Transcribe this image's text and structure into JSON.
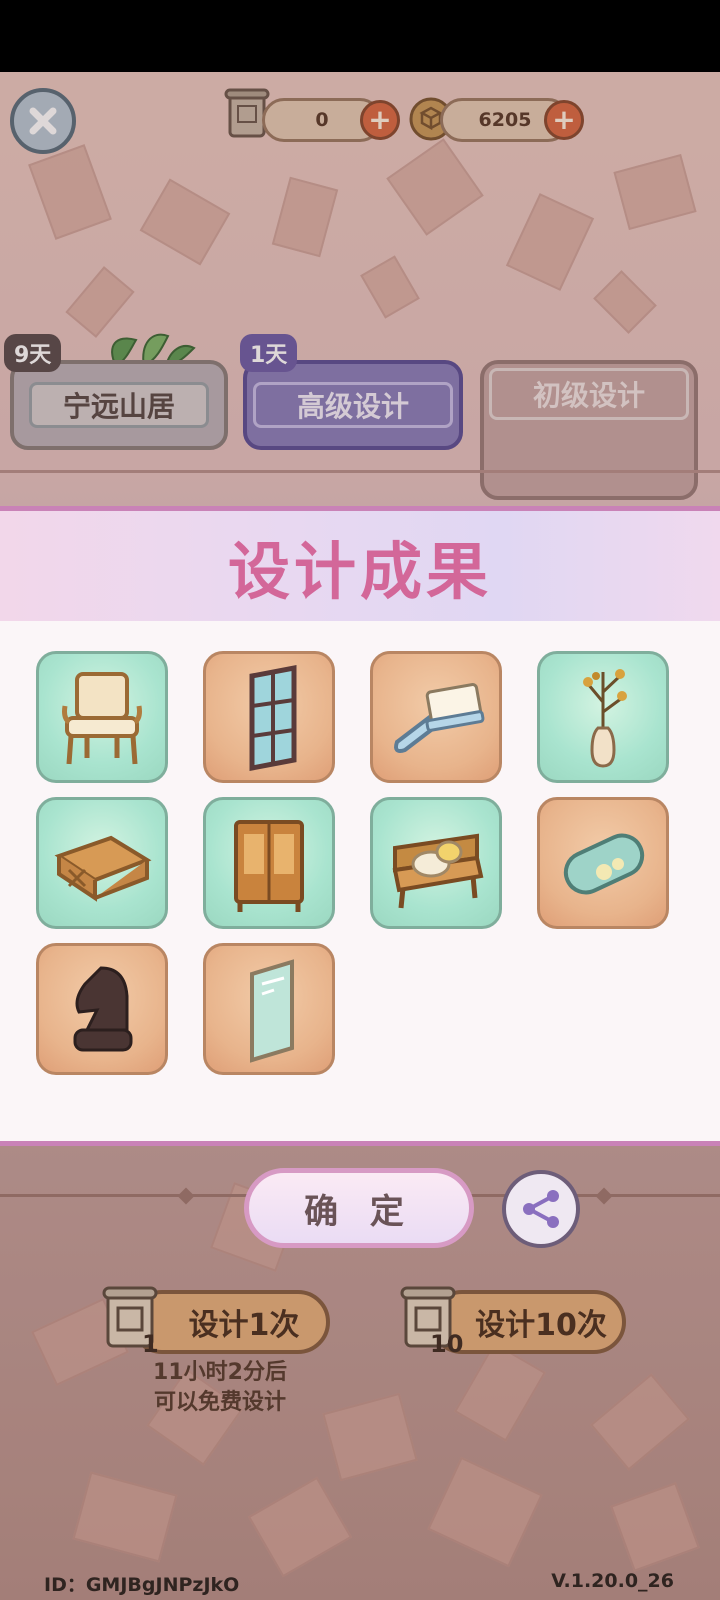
{
  "currency": {
    "scrolls": "0",
    "coins": "6205"
  },
  "tabs": [
    {
      "badge": "9天",
      "label": "宁远山居"
    },
    {
      "badge": "1天",
      "label": "高级设计"
    },
    {
      "label": "初级设计"
    }
  ],
  "modal": {
    "title": "设计成果",
    "items": [
      {
        "icon": "rattan-chair-icon",
        "rarity": "green"
      },
      {
        "icon": "window-frame-icon",
        "rarity": "orange"
      },
      {
        "icon": "brush-icon",
        "rarity": "orange"
      },
      {
        "icon": "vase-branch-icon",
        "rarity": "green"
      },
      {
        "icon": "wooden-table-icon",
        "rarity": "green"
      },
      {
        "icon": "cabinet-icon",
        "rarity": "green"
      },
      {
        "icon": "bench-with-pillows-icon",
        "rarity": "green"
      },
      {
        "icon": "bolster-pillow-icon",
        "rarity": "orange"
      },
      {
        "icon": "chess-knight-icon",
        "rarity": "orange"
      },
      {
        "icon": "mirror-icon",
        "rarity": "orange"
      }
    ]
  },
  "confirm_label": "确 定",
  "design_once": {
    "label": "设计1次",
    "cost": "1"
  },
  "design_ten": {
    "label": "设计10次",
    "cost": "10"
  },
  "free_text_1": "11小时2分后",
  "free_text_2": "可以免费设计",
  "footer": {
    "id": "ID：GMJBgJNPzJkO",
    "version": "V.1.20.0_26"
  }
}
